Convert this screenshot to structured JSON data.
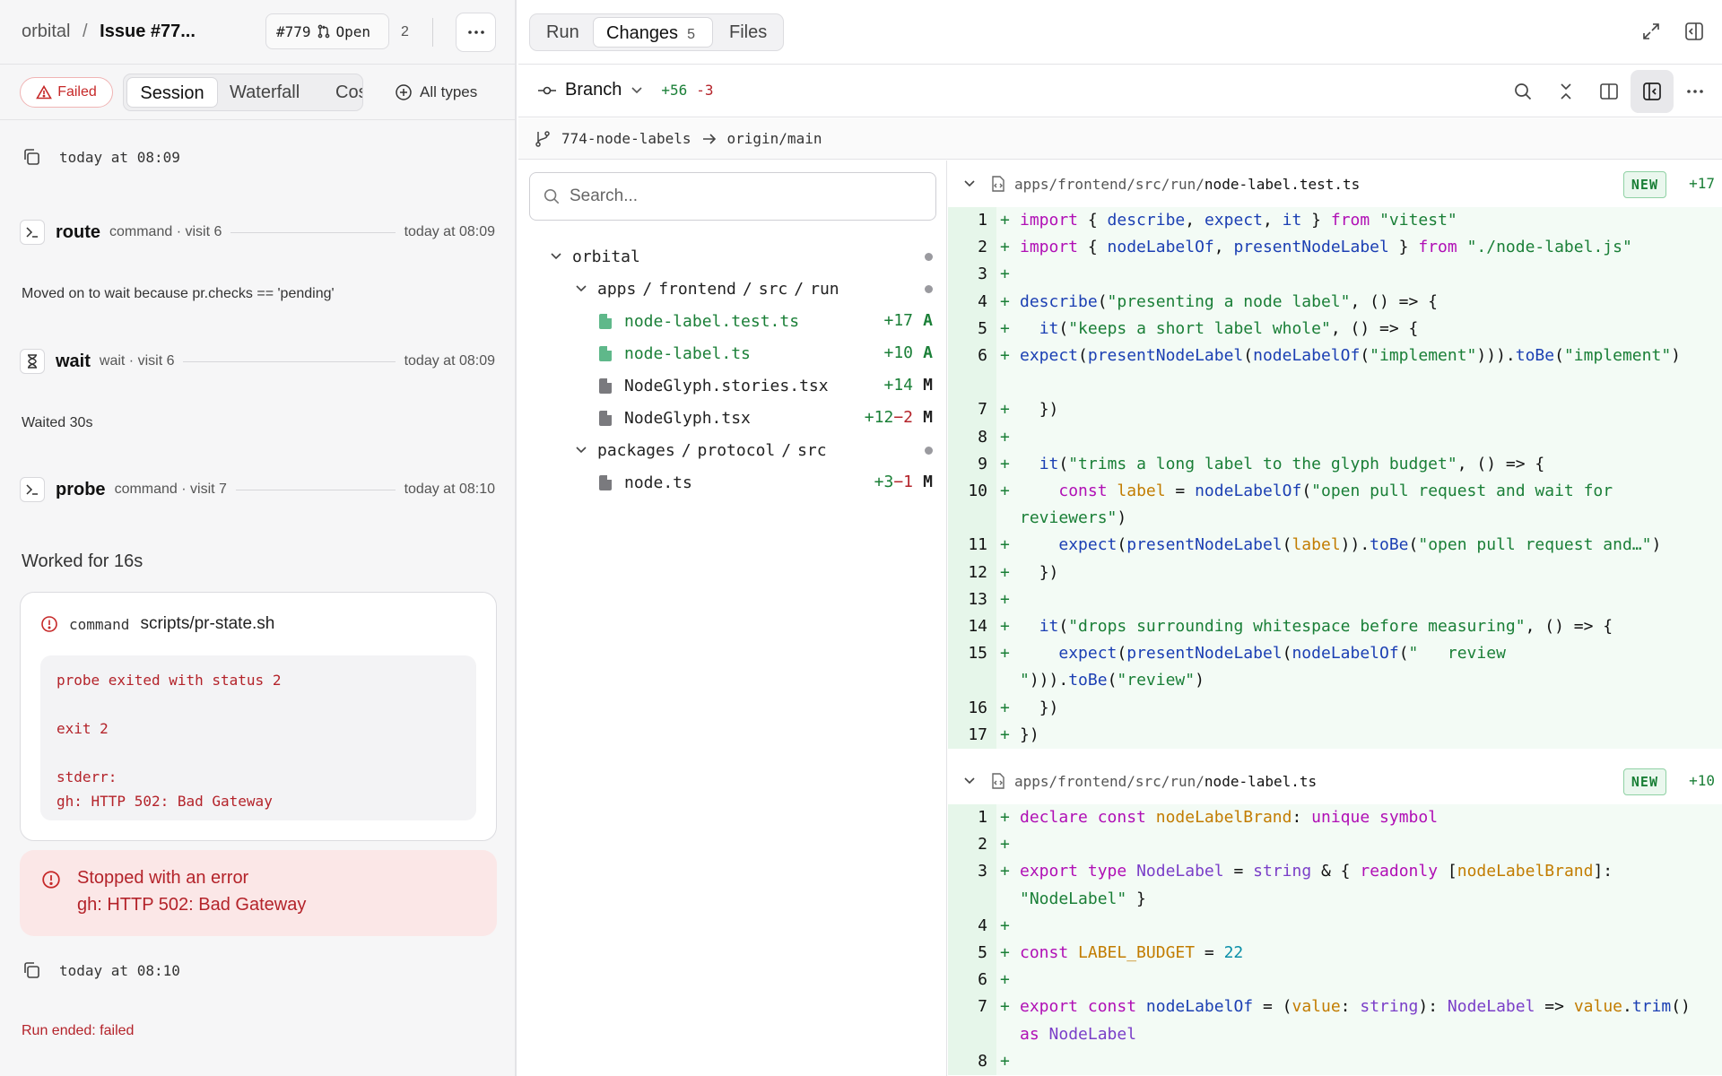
{
  "left": {
    "breadcrumb": {
      "project": "orbital",
      "sep": "/",
      "issue": "Issue #77..."
    },
    "issue_pill": {
      "number": "#779",
      "status": "Open"
    },
    "issue_count": "2",
    "more_label": "···",
    "failed_badge": "Failed",
    "segments": {
      "session": "Session",
      "waterfall": "Waterfall",
      "cost": "Cost"
    },
    "all_types": "All types",
    "timeline": {
      "ts1": "today at 08:09",
      "route": {
        "name": "route",
        "meta": "command · visit 6",
        "time": "today at 08:09"
      },
      "route_note": "Moved on to wait because pr.checks == 'pending'",
      "wait": {
        "name": "wait",
        "meta": "wait · visit 6",
        "time": "today at 08:09"
      },
      "wait_note": "Waited 30s",
      "probe": {
        "name": "probe",
        "meta": "command · visit 7",
        "time": "today at 08:10"
      },
      "worked": "Worked for 16s",
      "cmd": {
        "kind": "command",
        "script": "scripts/pr-state.sh",
        "output": "probe exited with status 2\n\nexit 2\n\nstderr:\ngh: HTTP 502: Bad Gateway"
      },
      "stopped": {
        "title": "Stopped with an error",
        "detail": "gh: HTTP 502: Bad Gateway"
      },
      "ts2": "today at 08:10",
      "run_end": "Run ended: failed"
    }
  },
  "tabs": {
    "run": "Run",
    "changes": "Changes",
    "changes_count": "5",
    "files": "Files"
  },
  "toolbar": {
    "branch": "Branch",
    "added": "+56",
    "removed": "-3"
  },
  "path": {
    "from": "774-node-labels",
    "to": "origin/main"
  },
  "tree": {
    "search_placeholder": "Search...",
    "root": "orbital",
    "dir1": [
      "apps",
      "frontend",
      "src",
      "run"
    ],
    "dir2": [
      "packages",
      "protocol",
      "src"
    ],
    "files": [
      {
        "name": "node-label.test.ts",
        "added": "+17",
        "removed": "",
        "status": "A"
      },
      {
        "name": "node-label.ts",
        "added": "+10",
        "removed": "",
        "status": "A"
      },
      {
        "name": "NodeGlyph.stories.tsx",
        "added": "+14",
        "removed": "",
        "status": "M"
      },
      {
        "name": "NodeGlyph.tsx",
        "added": "+12",
        "removed": "−2",
        "status": "M"
      },
      {
        "name": "node.ts",
        "added": "+3",
        "removed": "−1",
        "status": "M"
      }
    ]
  },
  "diff": {
    "file1": {
      "dir": "apps/frontend/src/run/",
      "name": "node-label.test.ts",
      "badge": "NEW",
      "added": "+17"
    },
    "file2": {
      "dir": "apps/frontend/src/run/",
      "name": "node-label.ts",
      "badge": "NEW",
      "added": "+10"
    },
    "line_numbers1": [
      "1",
      "2",
      "3",
      "4",
      "5",
      "6",
      "7",
      "8",
      "9",
      "10",
      "11",
      "12",
      "13",
      "14",
      "15",
      "16",
      "17"
    ],
    "line_numbers2": [
      "1",
      "2",
      "3",
      "4",
      "5",
      "6",
      "7",
      "8"
    ],
    "plus_sign": "+",
    "colors": {
      "added": "#1a7f37",
      "removed": "#b4232a",
      "keyword": "#b00fb5",
      "string": "#1a7f37",
      "variable": "#c27c00",
      "function": "#1b3fb3"
    },
    "code1": [
      "import { describe, expect, it } from \"vitest\"",
      "import { nodeLabelOf, presentNodeLabel } from \"./node-label.js\"",
      "",
      "describe(\"presenting a node label\", () => {",
      "  it(\"keeps a short label whole\", () => {",
      "expect(presentNodeLabel(nodeLabelOf(\"implement\"))).toBe(\"implement\")",
      "  })",
      "",
      "  it(\"trims a long label to the glyph budget\", () => {",
      "    const label = nodeLabelOf(\"open pull request and wait for reviewers\")",
      "    expect(presentNodeLabel(label)).toBe(\"open pull request and…\")",
      "  })",
      "",
      "  it(\"drops surrounding whitespace before measuring\", () => {",
      "    expect(presentNodeLabel(nodeLabelOf(\"   review   \"))).toBe(\"review\")",
      "  })",
      "})"
    ],
    "code2": [
      "declare const nodeLabelBrand: unique symbol",
      "",
      "export type NodeLabel = string & { readonly [nodeLabelBrand]: \"NodeLabel\" }",
      "",
      "const LABEL_BUDGET = 22",
      "",
      "export const nodeLabelOf = (value: string): NodeLabel => value.trim() as NodeLabel",
      ""
    ]
  },
  "icons": [
    "copy-icon",
    "terminal-icon",
    "hourglass-icon",
    "alert-circle-icon",
    "triangle-alert-icon",
    "pull-request-icon",
    "plus-circle-icon",
    "commit-icon",
    "chevron-down-icon",
    "branch-icon",
    "arrow-right-icon",
    "search-icon",
    "collapse-icon",
    "columns-icon",
    "sidebar-left-icon",
    "more-icon",
    "expand-icon",
    "panel-right-icon",
    "file-icon",
    "code-file-icon"
  ]
}
